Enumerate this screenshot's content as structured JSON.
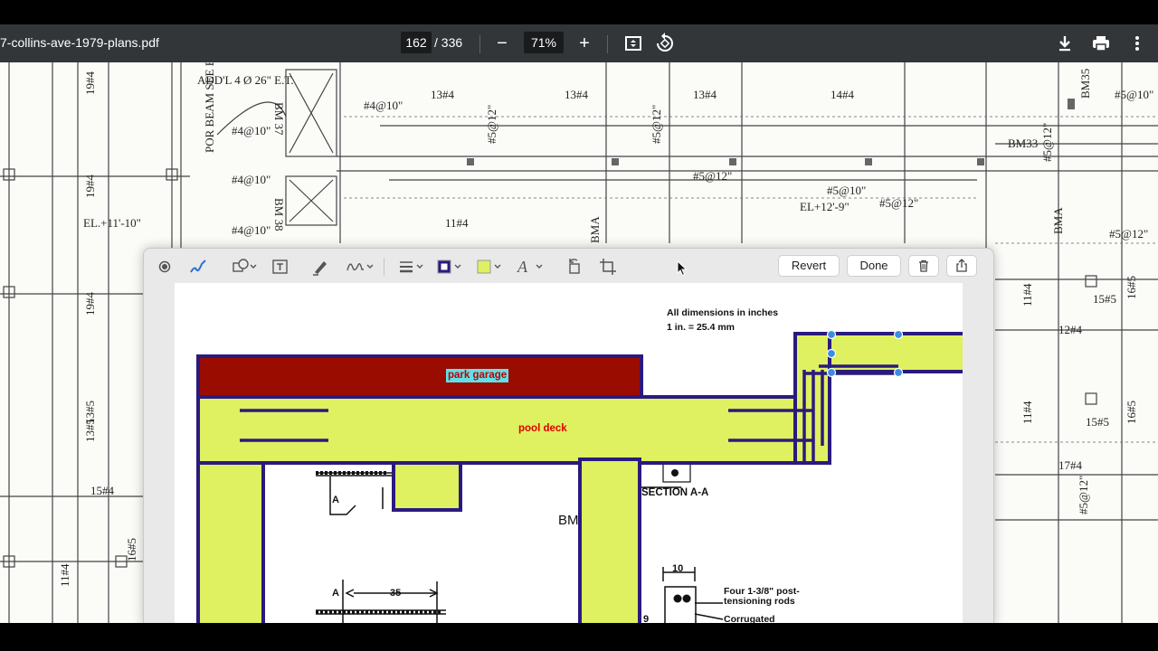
{
  "viewer": {
    "filename": "7-collins-ave-1979-plans.pdf",
    "page_current": "162",
    "page_total": "/ 336",
    "zoom": "71%",
    "zoom_out_label": "−",
    "zoom_in_label": "+"
  },
  "markup_toolbar": {
    "revert_label": "Revert",
    "done_label": "Done",
    "border_color": "#2b1a7e",
    "fill_color": "#dff060"
  },
  "drawing": {
    "park_garage_label": "park garage",
    "pool_deck_label": "pool deck",
    "garage_color": "#9b0c00",
    "deck_color": "#dff060",
    "outline_color": "#2b1a7e",
    "dims_line1": "All dimensions in inches",
    "dims_line2": "1 in. = 25.4 mm",
    "section_label": "SECTION A-A",
    "bm_label": "BM",
    "dim_10": "10",
    "dim_35": "35",
    "dim_9": "9",
    "section_marker_a": "A",
    "rods_line1": "Four 1-3/8\" post-",
    "rods_line2": "tensioning rods",
    "corrugated_label": "Corrugated"
  },
  "blueprint": {
    "labels": [
      "ADD'L 4 Ø 26\" E.T.",
      "#4@10\"",
      "BM 37",
      "#4@10\"",
      "POR BEAM SEE ELEVATOR SECTION",
      "BM 38",
      "#4@10\"",
      "#4@10\"",
      "EL.+11'-10\"",
      "13#4",
      "13#4",
      "13#4",
      "14#4",
      "BM35",
      "#5@10\"",
      "BM33",
      "#5@12\"",
      "11#4",
      "#5@12\"",
      "#5@12\"",
      "#5@10\"",
      "EL+12'-9\"",
      "#5@12\"",
      "#5@12\"",
      "BMA",
      "BMA",
      "15#5",
      "16#5",
      "11#4",
      "12#4",
      "11#4",
      "15#5",
      "16#5",
      "17#4",
      "#5@12\"",
      "13#5",
      "15#4",
      "16#5",
      "11#4",
      "19#4",
      "19#4",
      "19#4",
      "13#5",
      "#5@12\""
    ]
  }
}
